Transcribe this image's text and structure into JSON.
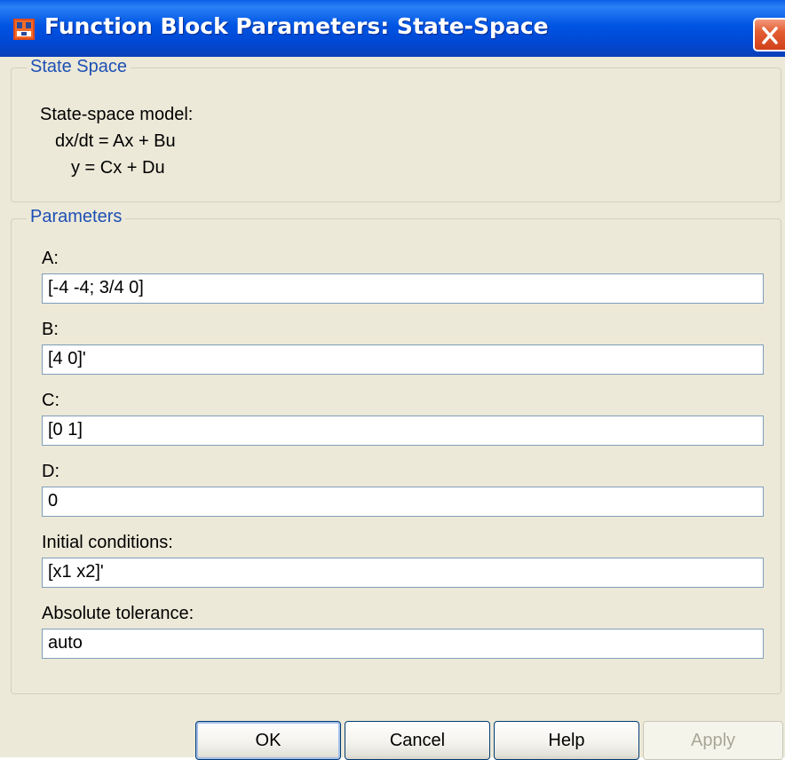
{
  "window": {
    "title": "Function Block Parameters: State-Space",
    "icon": "simulink-block-icon",
    "close_icon": "close-icon"
  },
  "description_group": {
    "legend": "State Space",
    "lines": [
      "State-space model:",
      "dx/dt = Ax + Bu",
      "y = Cx + Du"
    ]
  },
  "parameters_group": {
    "legend": "Parameters",
    "fields": [
      {
        "label": "A:",
        "value": "[-4 -4; 3/4 0]"
      },
      {
        "label": "B:",
        "value": "[4 0]'"
      },
      {
        "label": "C:",
        "value": "[0 1]"
      },
      {
        "label": "D:",
        "value": "0"
      },
      {
        "label": "Initial conditions:",
        "value": "[x1 x2]'"
      },
      {
        "label": "Absolute tolerance:",
        "value": "auto"
      }
    ]
  },
  "buttons": {
    "ok": "OK",
    "cancel": "Cancel",
    "help": "Help",
    "apply": "Apply"
  },
  "colors": {
    "titlebar": "#0054e3",
    "legend_text": "#1e4fb5",
    "dialog_background": "#ece9d8",
    "close_button": "#e35d33"
  }
}
